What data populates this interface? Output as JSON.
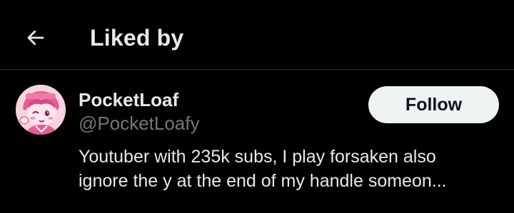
{
  "header": {
    "back_icon": "arrow-left-icon",
    "title": "Liked by"
  },
  "user": {
    "display_name": "PocketLoaf",
    "handle": "@PocketLoafy",
    "bio_lines": [
      "Youtuber with 235k subs, I play forsaken also",
      "ignore the y at the end of my handle someon..."
    ],
    "follow_label": "Follow",
    "avatar_icon": "pink-character-avatar"
  },
  "colors": {
    "background": "#000000",
    "primary_text": "#e7e9ea",
    "secondary_text": "#71767b",
    "divider": "#2f3336",
    "follow_button_bg": "#eff3f4",
    "follow_button_text": "#0f1419"
  }
}
